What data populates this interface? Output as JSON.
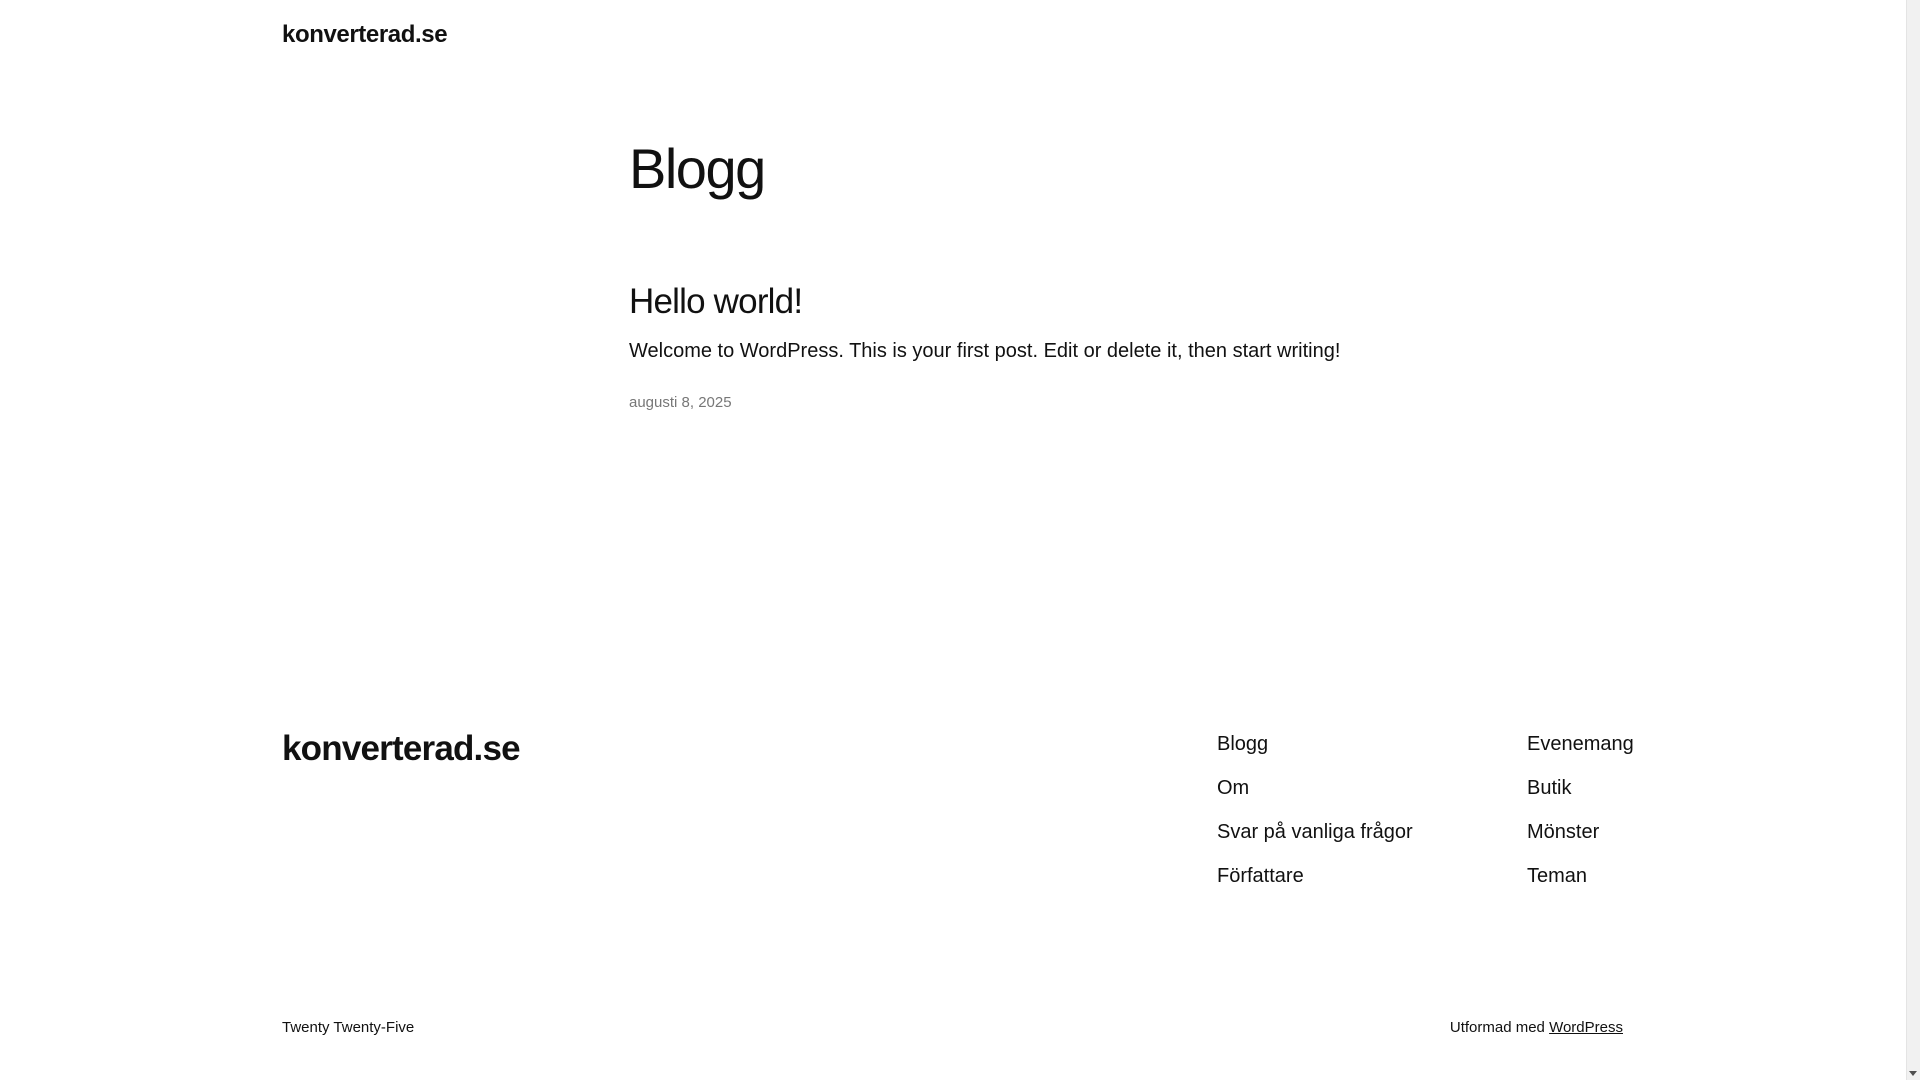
{
  "header": {
    "site_title": "konverterad.se"
  },
  "main": {
    "page_title": "Blogg",
    "posts": [
      {
        "title": "Hello world!",
        "excerpt": "Welcome to WordPress. This is your first post. Edit or delete it, then start writing!",
        "date": "augusti 8, 2025"
      }
    ]
  },
  "footer": {
    "site_title": "konverterad.se",
    "nav_col1": [
      "Blogg",
      "Om",
      "Svar på vanliga frågor",
      "Författare"
    ],
    "nav_col2": [
      "Evenemang",
      "Butik",
      "Mönster",
      "Teman"
    ],
    "theme_credit": "Twenty Twenty-Five",
    "credit_prefix": "Utformad med",
    "credit_link": "WordPress"
  },
  "scrollbar": {
    "icon": "chevron-down-icon"
  }
}
